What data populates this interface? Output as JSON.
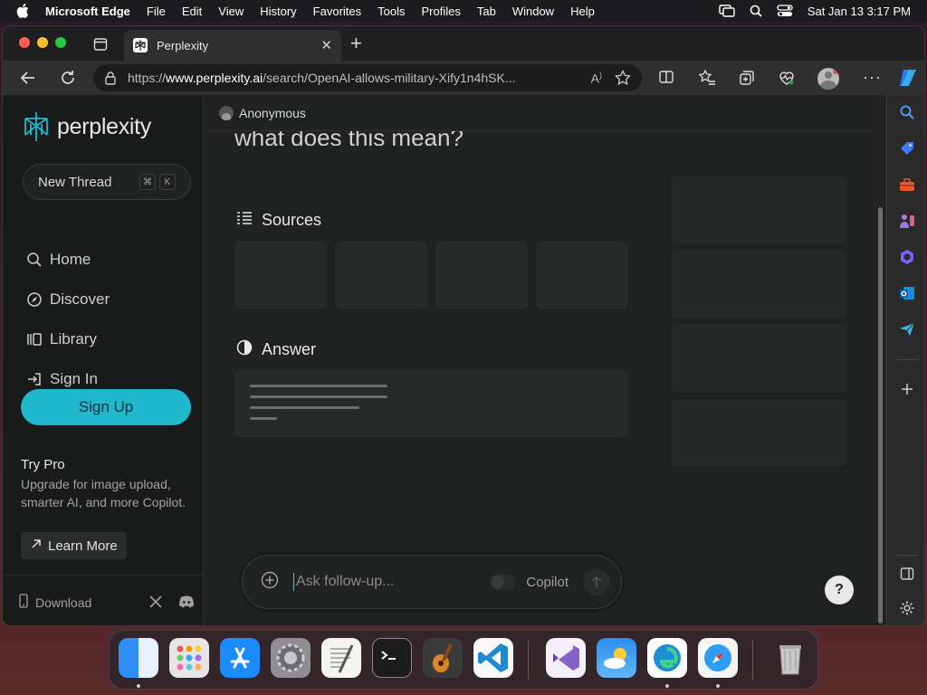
{
  "menubar": {
    "app_name": "Microsoft Edge",
    "items": [
      "File",
      "Edit",
      "View",
      "History",
      "Favorites",
      "Tools",
      "Profiles",
      "Tab",
      "Window",
      "Help"
    ],
    "datetime": "Sat Jan 13  3:17 PM"
  },
  "browser": {
    "tab_title": "Perplexity",
    "url_prefix": "https://",
    "url_domain": "www.perplexity.ai",
    "url_path": "/search/OpenAI-allows-military-Xify1n4hSK..."
  },
  "sidebar": {
    "logo_text": "perplexity",
    "new_thread": "New Thread",
    "shortcut_keys": [
      "⌘",
      "K"
    ],
    "nav": [
      {
        "label": "Home",
        "icon": "search-icon"
      },
      {
        "label": "Discover",
        "icon": "compass-icon"
      },
      {
        "label": "Library",
        "icon": "library-icon"
      },
      {
        "label": "Sign In",
        "icon": "sign-in-icon"
      }
    ],
    "signup": "Sign Up",
    "trypro_title": "Try Pro",
    "trypro_desc": "Upgrade for image upload, smarter AI, and more Copilot.",
    "learn_more": "Learn More",
    "download": "Download"
  },
  "main": {
    "user": "Anonymous",
    "question_partial": "what does this mean?",
    "sources_heading": "Sources",
    "answer_heading": "Answer",
    "ask_placeholder": "Ask follow-up...",
    "copilot_label": "Copilot",
    "help_label": "?"
  },
  "colors": {
    "accent": "#20b8cd",
    "background": "#202222",
    "sidebar": "#191a1a"
  }
}
